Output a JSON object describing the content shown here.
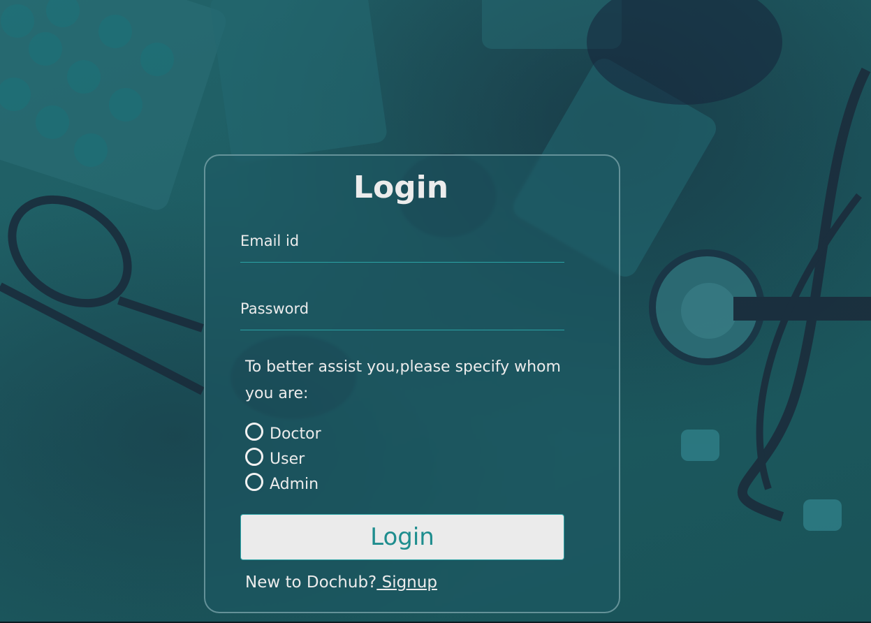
{
  "login_form": {
    "title": "Login",
    "email_label": "Email id",
    "password_label": "Password",
    "role_prompt": "To better assist you,please specify whom you are:",
    "roles": [
      {
        "label": "Doctor"
      },
      {
        "label": "User"
      },
      {
        "label": "Admin"
      }
    ],
    "submit_label": "Login",
    "signup_prompt": "New to Dochub?",
    "signup_link": " Signup"
  },
  "colors": {
    "background_teal": "#1d5a60",
    "accent_teal": "#2aa3a5",
    "button_bg": "#ebebeb",
    "button_text": "#1e8d8e",
    "text": "#ececec"
  }
}
